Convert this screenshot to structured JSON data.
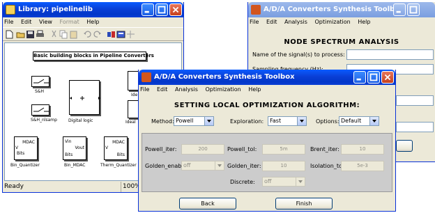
{
  "library": {
    "title": "Library: pipelinelib",
    "menu": [
      "File",
      "Edit",
      "View",
      "Format",
      "Help"
    ],
    "banner": "Basic building blocks in Pipeline Converters",
    "blocks": {
      "sh": "S&H",
      "sh_nl": "S&H_nlsamp",
      "digital": "Digital logic",
      "ideal1": "Ide",
      "ideal2": "Ideal",
      "binq": "Bin_Quantizer",
      "binmdac": "Bin_MDAC",
      "thermq": "Therm_Quantizer"
    },
    "ports": {
      "mdac": "MDAC",
      "bits": "Bits",
      "vin": "Vin",
      "vout": "Vout",
      "v": "V"
    },
    "status_left": "Ready",
    "status_right": "100%"
  },
  "back_window": {
    "title": "A/D/A Converters Synthesis Toolbox",
    "menu": [
      "File",
      "Edit",
      "Analysis",
      "Optimization",
      "Help"
    ],
    "heading": "NODE SPECTRUM ANALYSIS",
    "signal_label": "Name of the signal(s) to process:",
    "fs_label": "Sampling frequency (Hz):"
  },
  "front_window": {
    "title": "A/D/A Converters Synthesis Toolbox",
    "menu": [
      "File",
      "Edit",
      "Analysis",
      "Optimization",
      "Help"
    ],
    "heading": "SETTING  LOCAL OPTIMIZATION ALGORITHM:",
    "method_label": "Method:",
    "method_value": "Powell",
    "exploration_label": "Exploration:",
    "exploration_value": "Fast",
    "options_label": "Options:",
    "options_value": "Default",
    "powell_iter_label": "Powell_iter:",
    "powell_iter_value": "200",
    "powell_tol_label": "Powell_tol:",
    "powell_tol_value": "5m",
    "brent_iter_label": "Brent_iter:",
    "brent_iter_value": "10",
    "golden_enabl_label": "Golden_enabl",
    "golden_enabl_value": "off",
    "golden_iter_label": "Golden_iter:",
    "golden_iter_value": "10",
    "isolation_tol_label": "Isolation_tol:",
    "isolation_tol_value": "5e-3",
    "discrete_label": "Discrete:",
    "discrete_value": "off",
    "back_label": "Back",
    "finish_label": "Finish"
  },
  "colors": {
    "title_blue": "#0a3fd6",
    "close_red": "#c6401c",
    "panel_gray": "#cccccc",
    "window_bg": "#ece9d8"
  }
}
